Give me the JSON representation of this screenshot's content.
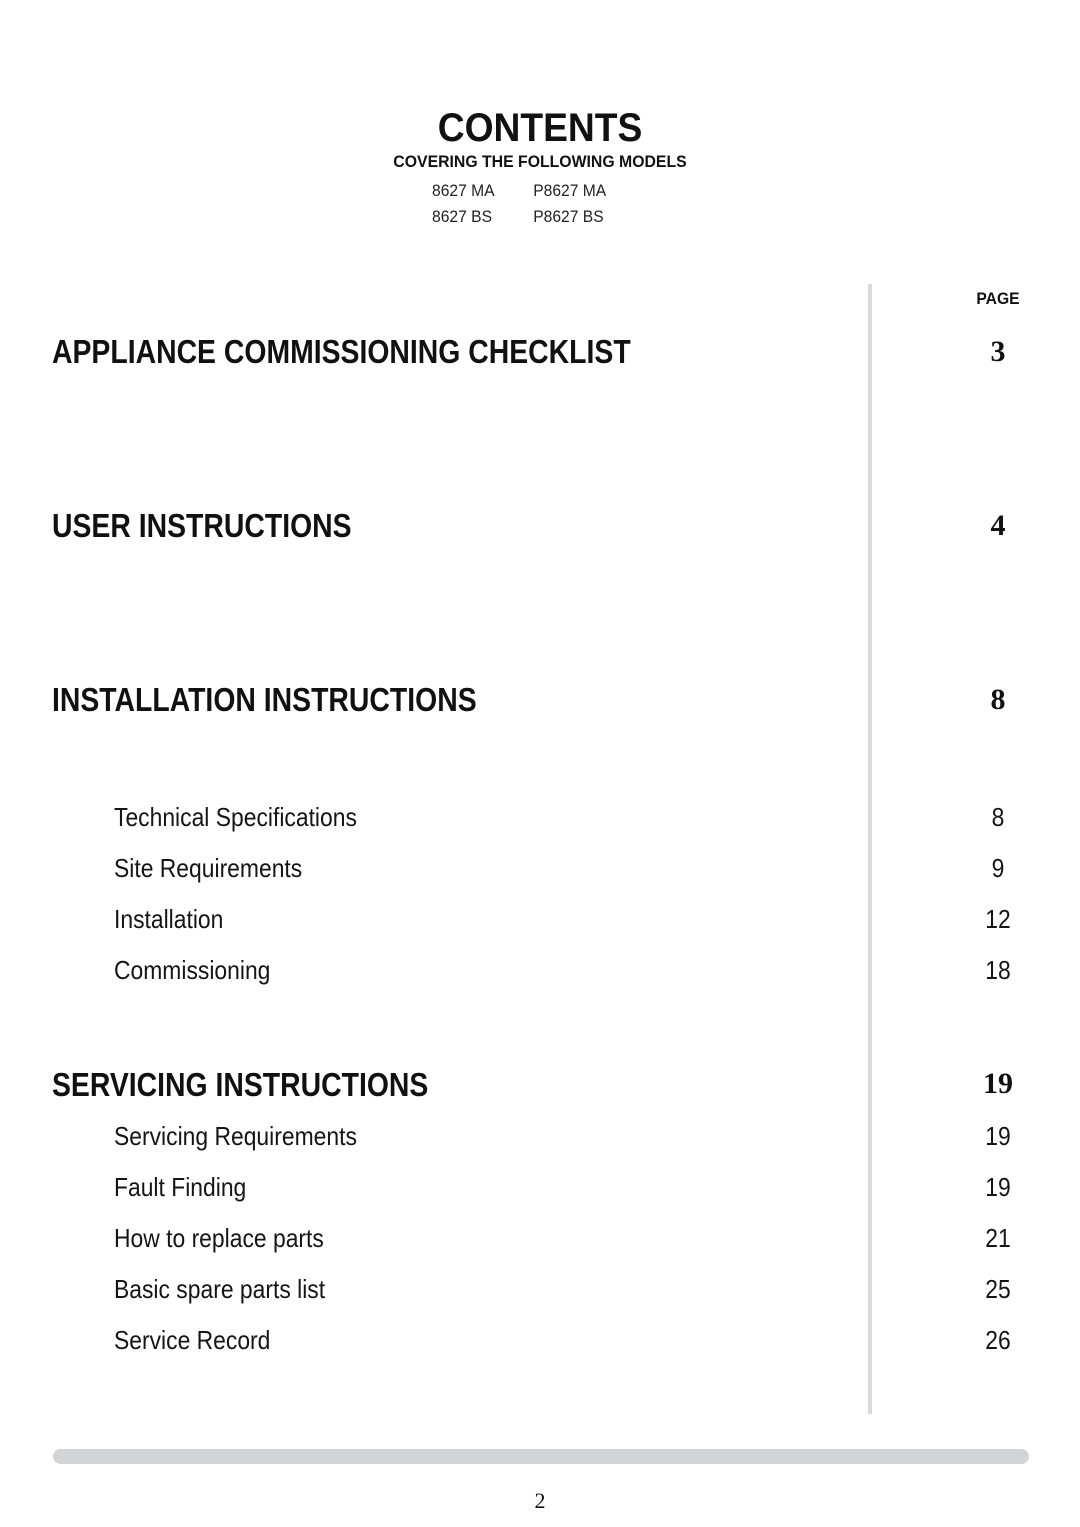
{
  "header": {
    "title": "CONTENTS",
    "subtitle": "COVERING THE FOLLOWING MODELS",
    "models": [
      [
        "8627 MA",
        "P8627 MA"
      ],
      [
        "8627 BS",
        "P8627 BS"
      ]
    ]
  },
  "page_column_label": "PAGE",
  "sections": [
    {
      "title": "APPLIANCE COMMISSIONING CHECKLIST",
      "page": "3",
      "items": []
    },
    {
      "title": "USER INSTRUCTIONS",
      "page": "4",
      "items": []
    },
    {
      "title": "INSTALLATION INSTRUCTIONS",
      "page": "8",
      "items": [
        {
          "label": "Technical Specifications",
          "page": "8"
        },
        {
          "label": "Site Requirements",
          "page": "9"
        },
        {
          "label": "Installation",
          "page": "12"
        },
        {
          "label": "Commissioning",
          "page": "18"
        }
      ]
    },
    {
      "title": "SERVICING INSTRUCTIONS",
      "page": "19",
      "items": [
        {
          "label": "Servicing Requirements",
          "page": "19"
        },
        {
          "label": "Fault Finding",
          "page": "19"
        },
        {
          "label": "How to replace parts",
          "page": "21"
        },
        {
          "label": "Basic spare parts list",
          "page": "25"
        },
        {
          "label": "Service Record",
          "page": "26"
        }
      ]
    }
  ],
  "footer": {
    "page_number": "2"
  },
  "colors": {
    "text": "#111111",
    "divider": "#d9d9d9",
    "bottom_bar": "#d3d4d6"
  }
}
